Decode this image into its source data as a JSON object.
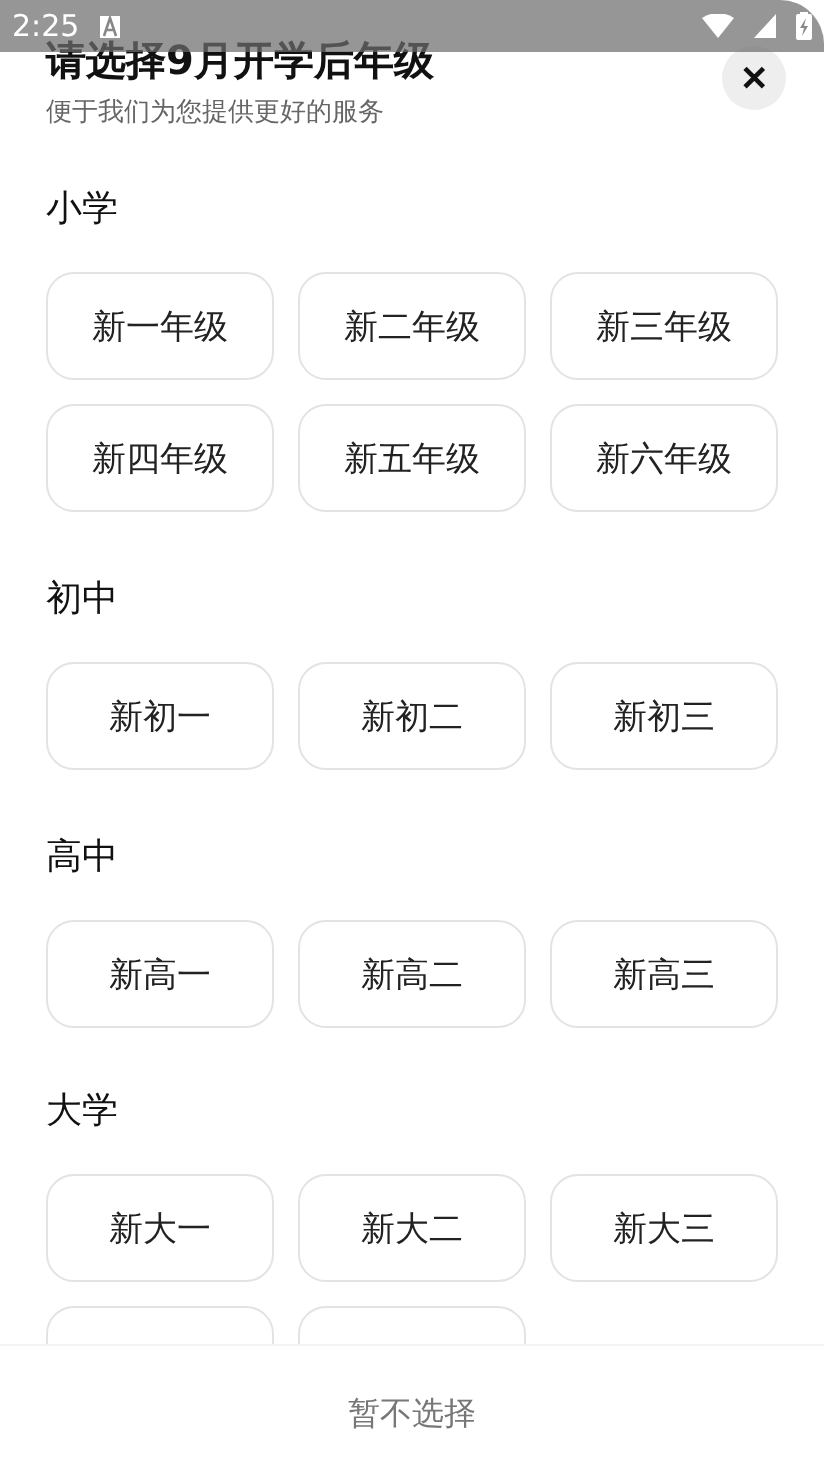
{
  "status_bar": {
    "time": "2:25"
  },
  "header": {
    "title": "请选择9月开学后年级",
    "subtitle": "便于我们为您提供更好的服务",
    "close_label": "✕"
  },
  "sections": [
    {
      "title": "小学",
      "options": [
        {
          "kind": "option",
          "label": "新一年级"
        },
        {
          "kind": "option",
          "label": "新二年级"
        },
        {
          "kind": "option",
          "label": "新三年级"
        },
        {
          "kind": "option",
          "label": "新四年级"
        },
        {
          "kind": "option",
          "label": "新五年级"
        },
        {
          "kind": "option",
          "label": "新六年级"
        }
      ]
    },
    {
      "title": "初中",
      "options": [
        {
          "kind": "option",
          "label": "新初一"
        },
        {
          "kind": "option",
          "label": "新初二"
        },
        {
          "kind": "option",
          "label": "新初三"
        }
      ]
    },
    {
      "title": "高中",
      "options": [
        {
          "kind": "option",
          "label": "新高一"
        },
        {
          "kind": "option",
          "label": "新高二"
        },
        {
          "kind": "option",
          "label": "新高三"
        }
      ]
    },
    {
      "title": "大学",
      "options": [
        {
          "kind": "option",
          "label": "新大一"
        },
        {
          "kind": "option",
          "label": "新大二"
        },
        {
          "kind": "option",
          "label": "新大三"
        },
        {
          "kind": "cut"
        },
        {
          "kind": "cut"
        }
      ]
    }
  ],
  "footer": {
    "skip": "暂不选择"
  }
}
